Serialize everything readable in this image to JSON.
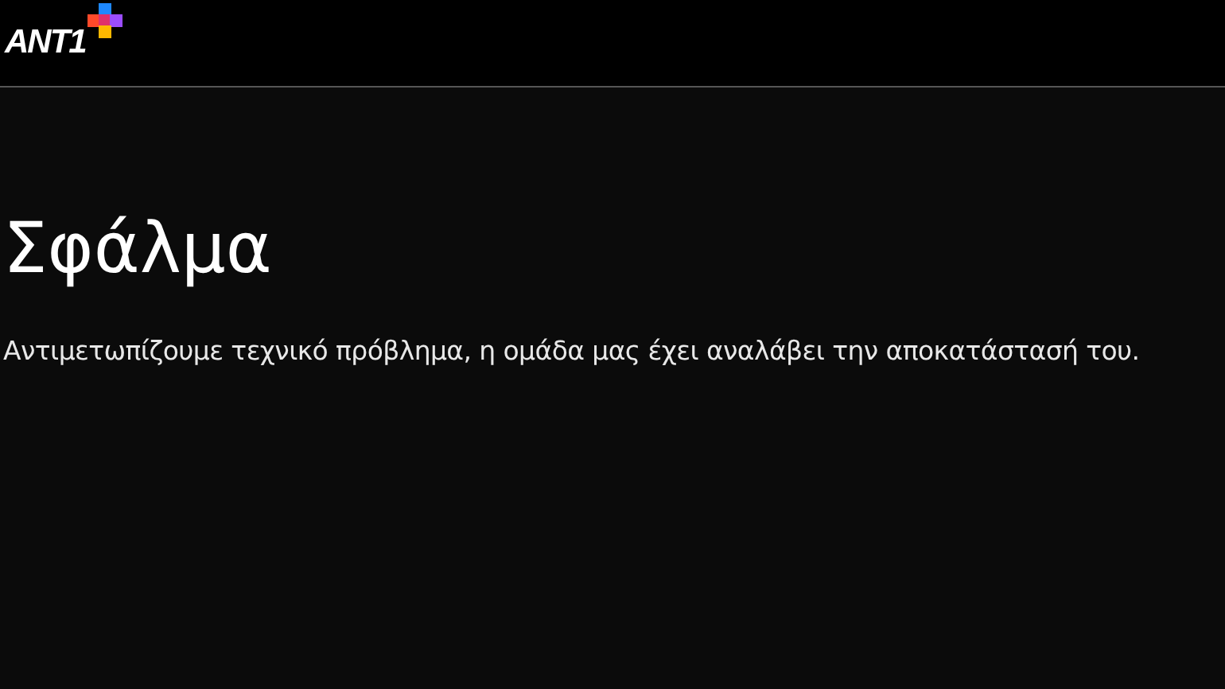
{
  "header": {
    "logo": {
      "text": "ANT1"
    }
  },
  "error": {
    "title": "Σφάλμα",
    "message": "Αντιμετωπίζουμε τεχνικό πρόβλημα, η ομάδα μας έχει αναλάβει την αποκατάστασή του."
  }
}
